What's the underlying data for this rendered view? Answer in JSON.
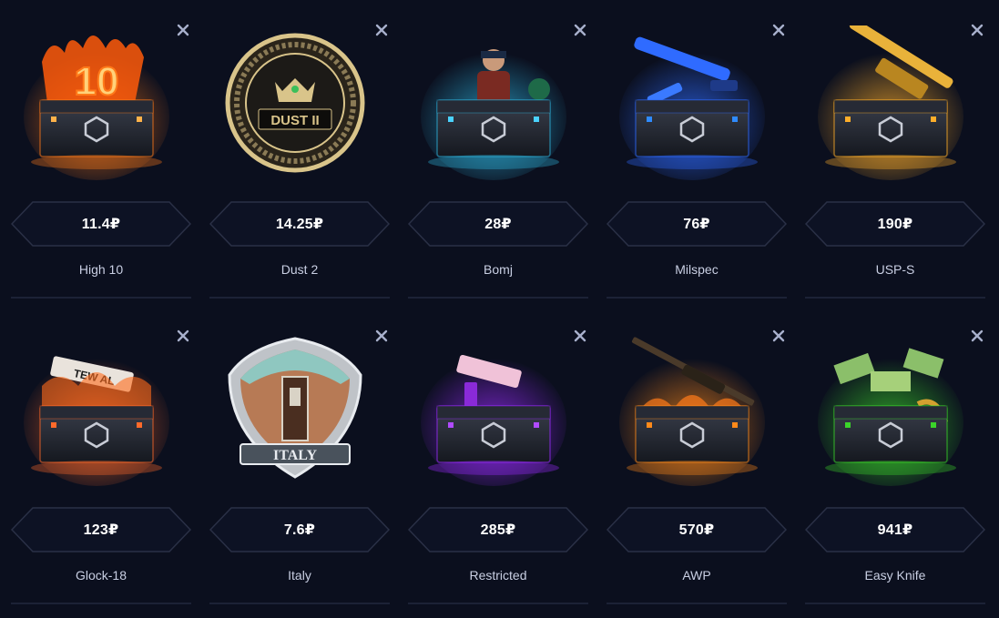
{
  "cases": [
    {
      "name": "High 10",
      "price": "11.4₽",
      "icon": "fire-case-10-icon",
      "accent": "#ff7a1a"
    },
    {
      "name": "Dust 2",
      "price": "14.25₽",
      "icon": "dust2-coin-icon",
      "accent": "#d9c48a"
    },
    {
      "name": "Bomj",
      "price": "28₽",
      "icon": "bomj-case-icon",
      "accent": "#2fb6e0"
    },
    {
      "name": "Milspec",
      "price": "76₽",
      "icon": "milspec-case-icon",
      "accent": "#2f6bff"
    },
    {
      "name": "USP-S",
      "price": "190₽",
      "icon": "usps-case-icon",
      "accent": "#ffae2a"
    },
    {
      "name": "Glock-18",
      "price": "123₽",
      "icon": "glock-case-icon",
      "accent": "#ff6a2a"
    },
    {
      "name": "Italy",
      "price": "7.6₽",
      "icon": "italy-badge-icon",
      "accent": "#b77a55"
    },
    {
      "name": "Restricted",
      "price": "285₽",
      "icon": "restricted-case-icon",
      "accent": "#9b2bff"
    },
    {
      "name": "AWP",
      "price": "570₽",
      "icon": "awp-case-icon",
      "accent": "#ff8a1a"
    },
    {
      "name": "Easy Knife",
      "price": "941₽",
      "icon": "easy-knife-case-icon",
      "accent": "#3bd42a"
    }
  ],
  "close_glyph": "✕"
}
